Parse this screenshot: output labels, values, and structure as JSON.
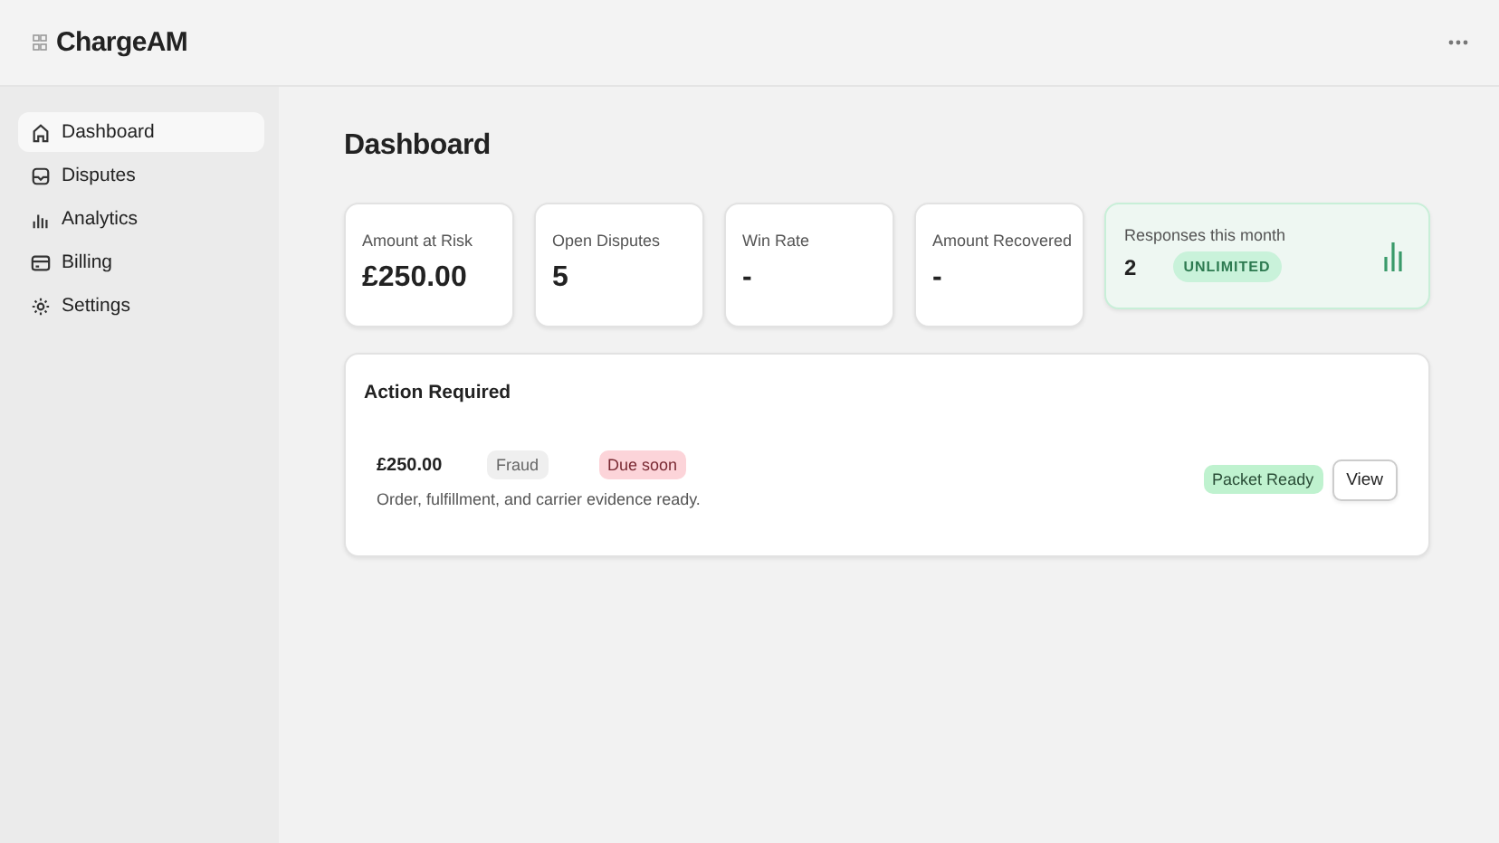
{
  "app": {
    "name": "ChargeAM"
  },
  "sidebar": {
    "items": [
      {
        "label": "Dashboard",
        "selected": true
      },
      {
        "label": "Disputes",
        "selected": false
      },
      {
        "label": "Analytics",
        "selected": false
      },
      {
        "label": "Billing",
        "selected": false
      },
      {
        "label": "Settings",
        "selected": false
      }
    ]
  },
  "page": {
    "title": "Dashboard"
  },
  "stats": [
    {
      "kind": "stat",
      "label": "Amount at Risk",
      "value": "£250.00"
    },
    {
      "kind": "stat",
      "label": "Open Disputes",
      "value": "5"
    },
    {
      "kind": "stat",
      "label": "Win Rate",
      "value": "-"
    },
    {
      "kind": "stat",
      "label": "Amount Recovered",
      "value": "-"
    },
    {
      "kind": "usage",
      "label": "Responses this month",
      "value": "2",
      "badge": "UNLIMITED"
    }
  ],
  "action_required": {
    "title": "Action Required",
    "items": [
      {
        "amount": "£250.00",
        "reason": "Fraud",
        "due": "Due soon",
        "description": "Order, fulfillment, and carrier evidence ready.",
        "status": "Packet Ready",
        "button": "View"
      }
    ]
  }
}
